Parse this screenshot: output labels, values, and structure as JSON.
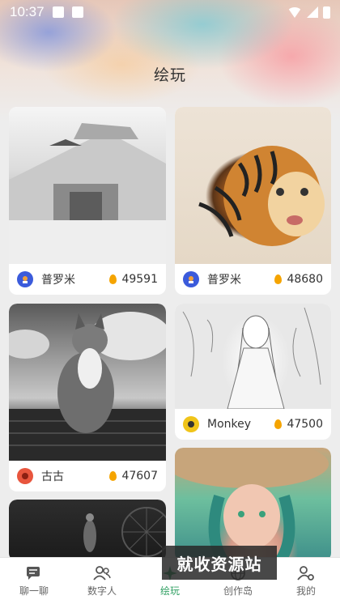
{
  "status_bar": {
    "time": "10:37"
  },
  "page": {
    "title": "绘玩"
  },
  "cards": [
    {
      "author": "普罗米",
      "likes": "49591",
      "avatar_color": "#3b5bdb",
      "image": "castle-sketch"
    },
    {
      "author": "普罗米",
      "likes": "48680",
      "avatar_color": "#3b5bdb",
      "image": "ink-tiger"
    },
    {
      "author": "古古",
      "likes": "47607",
      "avatar_color": "#e8553d",
      "image": "cat-on-roof"
    },
    {
      "author": "Monkey",
      "likes": "47500",
      "avatar_color": "#f0c419",
      "image": "anime-girl-sketch"
    }
  ],
  "nav": [
    {
      "label": "聊一聊",
      "icon": "chat-icon"
    },
    {
      "label": "数字人",
      "icon": "people-icon"
    },
    {
      "label": "绘玩",
      "icon": "sparkle-icon",
      "active": true
    },
    {
      "label": "创作岛",
      "icon": "globe-icon"
    },
    {
      "label": "我的",
      "icon": "user-settings-icon"
    }
  ],
  "watermark": "就收资源站",
  "colors": {
    "accent": "#2f9f62",
    "flame": "#f5a400",
    "background": "#ededed"
  }
}
